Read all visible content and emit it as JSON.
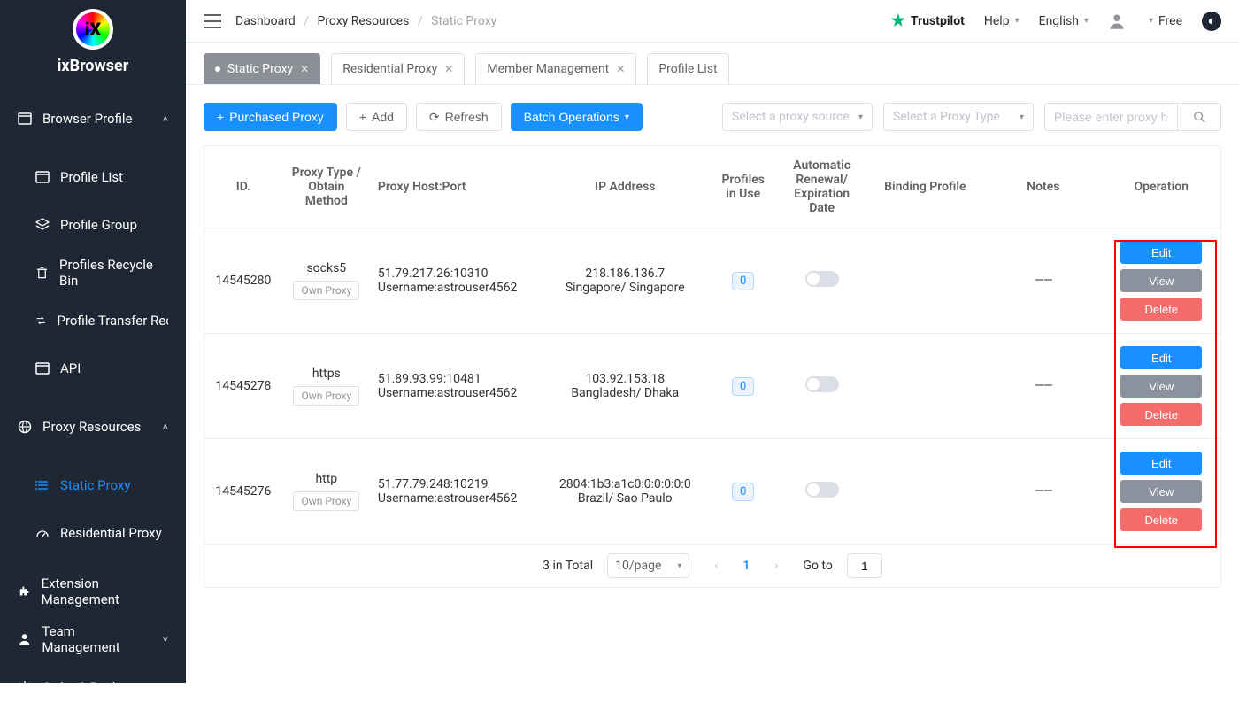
{
  "brand": {
    "name": "ixBrowser",
    "mark": "iX"
  },
  "sidebar": {
    "items": [
      {
        "label": "Browser Profile"
      },
      {
        "label": "Profile List"
      },
      {
        "label": "Profile Group"
      },
      {
        "label": "Profiles Recycle Bin"
      },
      {
        "label": "Profile Transfer Records"
      },
      {
        "label": "API"
      },
      {
        "label": "Proxy Resources"
      },
      {
        "label": "Static Proxy"
      },
      {
        "label": "Residential Proxy"
      },
      {
        "label": "Extension Management"
      },
      {
        "label": "Team Management"
      },
      {
        "label": "Order & Recharge"
      }
    ]
  },
  "breadcrumb": {
    "a": "Dashboard",
    "b": "Proxy Resources",
    "c": "Static Proxy"
  },
  "topbar": {
    "trustpilot": "Trustpilot",
    "help": "Help",
    "language": "English",
    "plan": "Free"
  },
  "tabs": [
    {
      "label": "Static Proxy"
    },
    {
      "label": "Residential Proxy"
    },
    {
      "label": "Member Management"
    },
    {
      "label": "Profile List"
    }
  ],
  "toolbar": {
    "purchased": "Purchased Proxy",
    "add": "Add",
    "refresh": "Refresh",
    "batch": "Batch Operations",
    "source_ph": "Select a proxy source",
    "type_ph": "Select a Proxy Type",
    "search_ph": "Please enter proxy ho"
  },
  "columns": {
    "id": "ID.",
    "type": "Proxy Type / Obtain Method",
    "host": "Proxy Host:Port",
    "ip": "IP Address",
    "profiles": "Profiles in Use",
    "renew": "Automatic Renewal/ Expiration Date",
    "binding": "Binding Profile",
    "notes": "Notes",
    "op": "Operation"
  },
  "op_labels": {
    "edit": "Edit",
    "view": "View",
    "delete": "Delete"
  },
  "own_proxy_label": "Own Proxy",
  "notes_dash": "——",
  "rows": [
    {
      "id": "14545280",
      "type": "socks5",
      "host_line": "51.79.217.26:10310",
      "user_line": "Username:astrouser4562",
      "ip_line1": "218.186.136.7",
      "ip_line2": "Singapore/ Singapore",
      "profiles": "0"
    },
    {
      "id": "14545278",
      "type": "https",
      "host_line": "51.89.93.99:10481",
      "user_line": "Username:astrouser4562",
      "ip_line1": "103.92.153.18",
      "ip_line2": "Bangladesh/ Dhaka",
      "profiles": "0"
    },
    {
      "id": "14545276",
      "type": "http",
      "host_line": "51.77.79.248:10219",
      "user_line": "Username:astrouser4562",
      "ip_line1": "2804:1b3:a1c0:0:0:0:0:0",
      "ip_line2": "Brazil/ Sao Paulo",
      "profiles": "0"
    }
  ],
  "pager": {
    "total": "3 in Total",
    "size": "10/page",
    "current": "1",
    "goto_label": "Go to",
    "goto_value": "1"
  }
}
